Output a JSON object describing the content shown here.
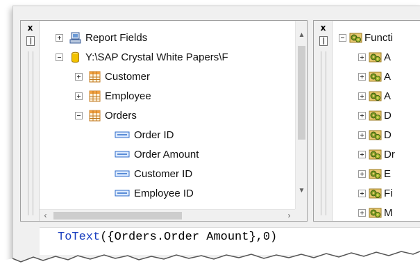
{
  "field_explorer": {
    "close_glyph": "x",
    "items": [
      {
        "label": "Report Fields",
        "icon": "report-fields-icon",
        "expander": "plus"
      },
      {
        "label": "Y:\\SAP Crystal White Papers\\F",
        "icon": "database-icon",
        "expander": "minus"
      },
      {
        "label": "Customer",
        "icon": "table-icon",
        "expander": "plus"
      },
      {
        "label": "Employee",
        "icon": "table-icon",
        "expander": "plus"
      },
      {
        "label": "Orders",
        "icon": "table-icon",
        "expander": "minus"
      },
      {
        "label": "Order ID",
        "icon": "field-icon"
      },
      {
        "label": "Order Amount",
        "icon": "field-icon"
      },
      {
        "label": "Customer ID",
        "icon": "field-icon"
      },
      {
        "label": "Employee ID",
        "icon": "field-icon"
      }
    ]
  },
  "function_tree": {
    "close_glyph": "x",
    "root_label": "Functi",
    "items": [
      {
        "label": "A"
      },
      {
        "label": "A"
      },
      {
        "label": "A"
      },
      {
        "label": "D"
      },
      {
        "label": "D"
      },
      {
        "label": "Dr"
      },
      {
        "label": "E"
      },
      {
        "label": "Fi"
      },
      {
        "label": "M"
      }
    ]
  },
  "formula": {
    "function_name": "ToText",
    "arguments": "({Orders.Order Amount},0)"
  },
  "colors": {
    "formula_function": "#1a3fbf",
    "table_icon": "#f0a040",
    "database_icon": "#f2c200",
    "field_icon": "#2f6cc8"
  }
}
